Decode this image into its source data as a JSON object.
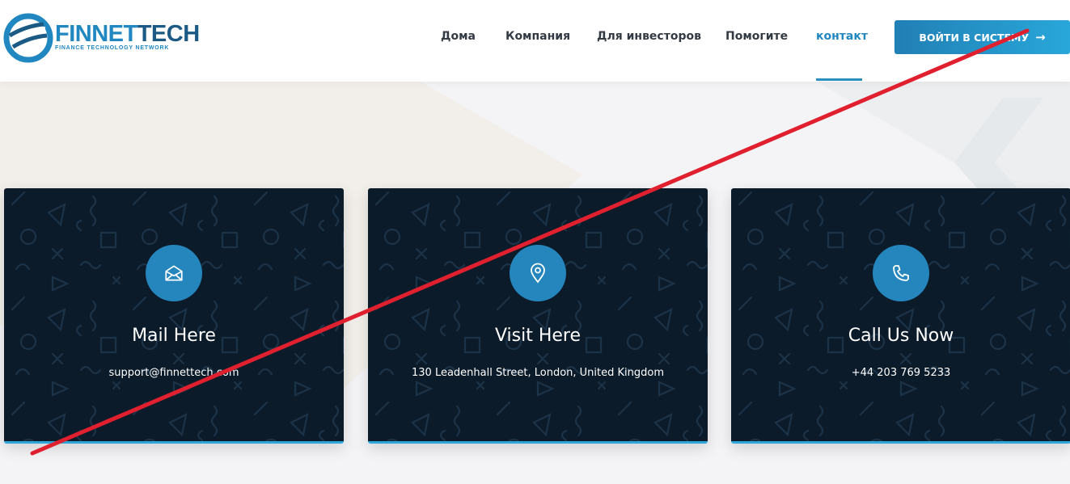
{
  "brand": {
    "name_part1": "FINNET",
    "name_part2": "TECH",
    "tagline": "FINANCE TECHNOLOGY NETWORK"
  },
  "nav": {
    "items": [
      "Дома",
      "Компания",
      "Для инвесторов",
      "Помогите",
      "контакт"
    ],
    "active": "контакт"
  },
  "login_button": {
    "label": "ВОЙТИ В СИСТЕМУ",
    "icon": "arrow-right-icon",
    "arrow": "→"
  },
  "cards": [
    {
      "icon": "envelope-icon",
      "title": "Mail Here",
      "text": "support@finnettech.com"
    },
    {
      "icon": "map-pin-icon",
      "title": "Visit Here",
      "text": "130 Leadenhall Street, London, United Kingdom"
    },
    {
      "icon": "phone-icon",
      "title": "Call Us Now",
      "text": "+44 203 769 5233"
    }
  ],
  "colors": {
    "accent": "#2187c0",
    "card_bg": "#0b1b2a",
    "strike": "#e0202e"
  }
}
